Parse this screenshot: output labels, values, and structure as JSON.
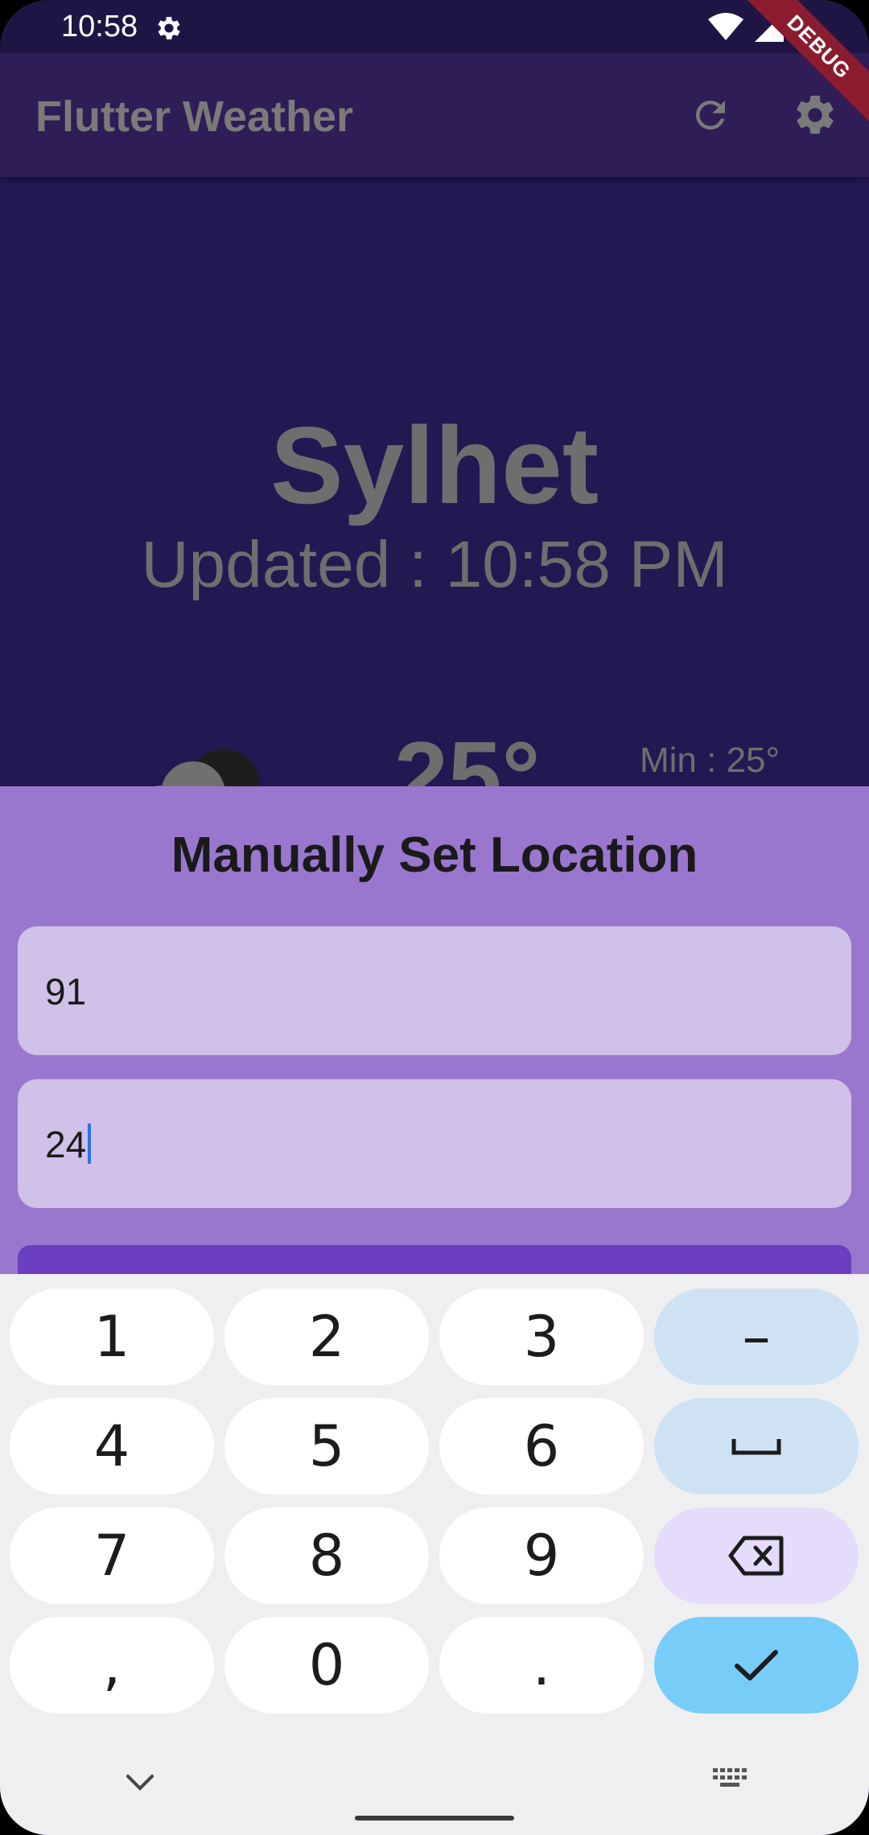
{
  "status_bar": {
    "time": "10:58",
    "icons": [
      "settings-icon",
      "wifi-icon",
      "signal-icon",
      "battery-icon"
    ]
  },
  "debug_banner": "DEBUG",
  "app_bar": {
    "title": "Flutter Weather",
    "actions": [
      "refresh-icon",
      "settings-icon"
    ]
  },
  "weather": {
    "city": "Sylhet",
    "updated": "Updated : 10:58 PM",
    "temperature": "25°",
    "min": "Min : 25°",
    "condition_icon": "cloudy-icon"
  },
  "sheet": {
    "title": "Manually Set Location",
    "field1_value": "91",
    "field2_value": "24"
  },
  "keyboard": {
    "rows": [
      [
        "1",
        "2",
        "3",
        "–"
      ],
      [
        "4",
        "5",
        "6",
        "␣"
      ],
      [
        "7",
        "8",
        "9",
        "⌫"
      ],
      [
        ",",
        "0",
        ".",
        "✓"
      ]
    ]
  },
  "colors": {
    "background": "#231852",
    "app_bar": "#2e1d56",
    "sheet": "#9a77cf",
    "field": "#cfc1e7",
    "button": "#6b3fbf",
    "enter_key": "#77cdf8"
  }
}
